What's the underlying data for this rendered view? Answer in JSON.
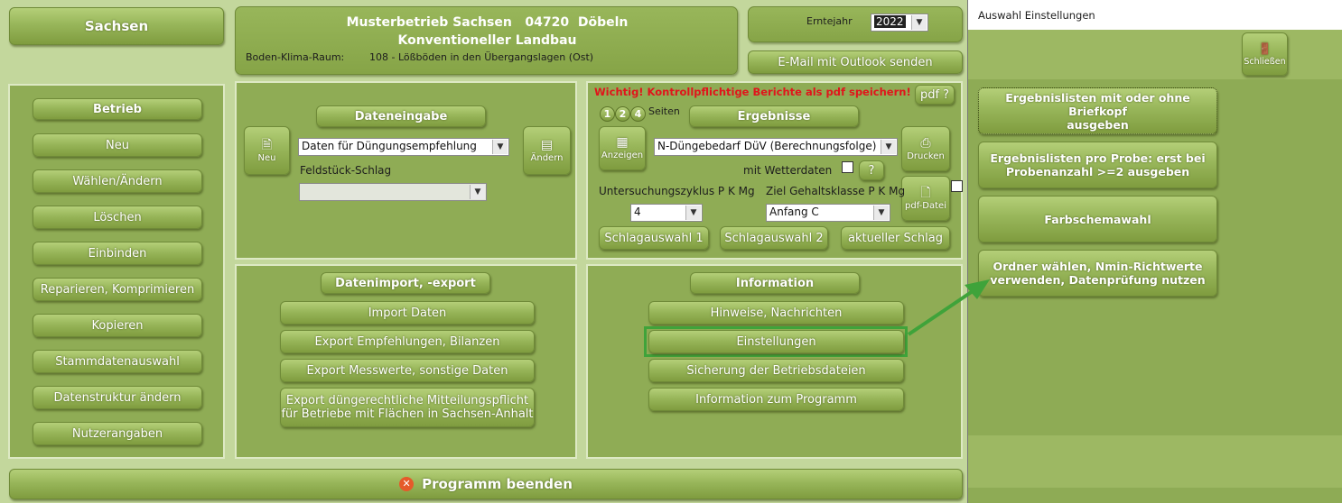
{
  "header": {
    "state": "Sachsen",
    "farm_line": "Musterbetrieb Sachsen   04720  Döbeln",
    "farming_type": "Konventioneller Landbau",
    "soil_label": "Boden-Klima-Raum:",
    "soil_value": "108 - Lößböden in den Übergangslagen (Ost)",
    "harvest_year_label": "Erntejahr",
    "harvest_year_value": "2022",
    "email_button": "E-Mail mit Outlook senden"
  },
  "betrieb": {
    "title": "Betrieb",
    "items": [
      "Neu",
      "Wählen/Ändern",
      "Löschen",
      "Einbinden",
      "Reparieren, Komprimieren",
      "Kopieren",
      "Stammdatenauswahl",
      "Datenstruktur ändern",
      "Nutzerangaben"
    ]
  },
  "dateneingabe": {
    "title": "Dateneingabe",
    "new_label": "Neu",
    "edit_label": "Ändern",
    "data_select": "Daten für Düngungsempfehlung",
    "field_label": "Feldstück-Schlag",
    "field_select": ""
  },
  "ergebnisse": {
    "warning": "Wichtig! Kontrollpflichtige Berichte als pdf speichern!",
    "pdf_help": "pdf ?",
    "pages": [
      "1",
      "2",
      "4"
    ],
    "pages_label": "Seiten",
    "title": "Ergebnisse",
    "show_label": "Anzeigen",
    "report_select": "N-Düngebedarf DüV (Berechnungsfolge)",
    "print_label": "Drucken",
    "weather_label": "mit Wetterdaten",
    "help": "?",
    "pdf_file_label": "pdf-Datei",
    "cycle_label": "Untersuchungszyklus P K Mg",
    "cycle_value": "4",
    "target_label": "Ziel Gehaltsklasse P K Mg",
    "target_value": "Anfang C",
    "schlag1": "Schlagauswahl 1",
    "schlag2": "Schlagauswahl 2",
    "current": "aktueller Schlag"
  },
  "import_export": {
    "title": "Datenimport, -export",
    "items": [
      "Import Daten",
      "Export Empfehlungen, Bilanzen",
      "Export Messwerte, sonstige Daten"
    ],
    "last_line1": "Export düngerechtliche Mitteilungspflicht",
    "last_line2": "für Betriebe mit Flächen in Sachsen-Anhalt"
  },
  "information": {
    "title": "Information",
    "items": [
      "Hinweise, Nachrichten",
      "Einstellungen",
      "Sicherung der Betriebsdateien",
      "Information zum Programm"
    ]
  },
  "footer": {
    "quit": "Programm beenden"
  },
  "settings_dialog": {
    "title": "Auswahl Einstellungen",
    "close_label": "Schließen",
    "b1_line1": "Ergebnislisten mit oder ohne Briefkopf",
    "b1_line2": "ausgeben",
    "b2_line1": "Ergebnislisten pro Probe: erst bei",
    "b2_line2": "Probenanzahl >=2 ausgeben",
    "b3": "Farbschemawahl",
    "b4_line1": "Ordner wählen, Nmin-Richtwerte",
    "b4_line2": "verwenden, Datenprüfung nutzen"
  },
  "colors": {
    "accent_green": "#3fa33a",
    "warning_red": "#e0151b",
    "panel": "#8fac55"
  }
}
